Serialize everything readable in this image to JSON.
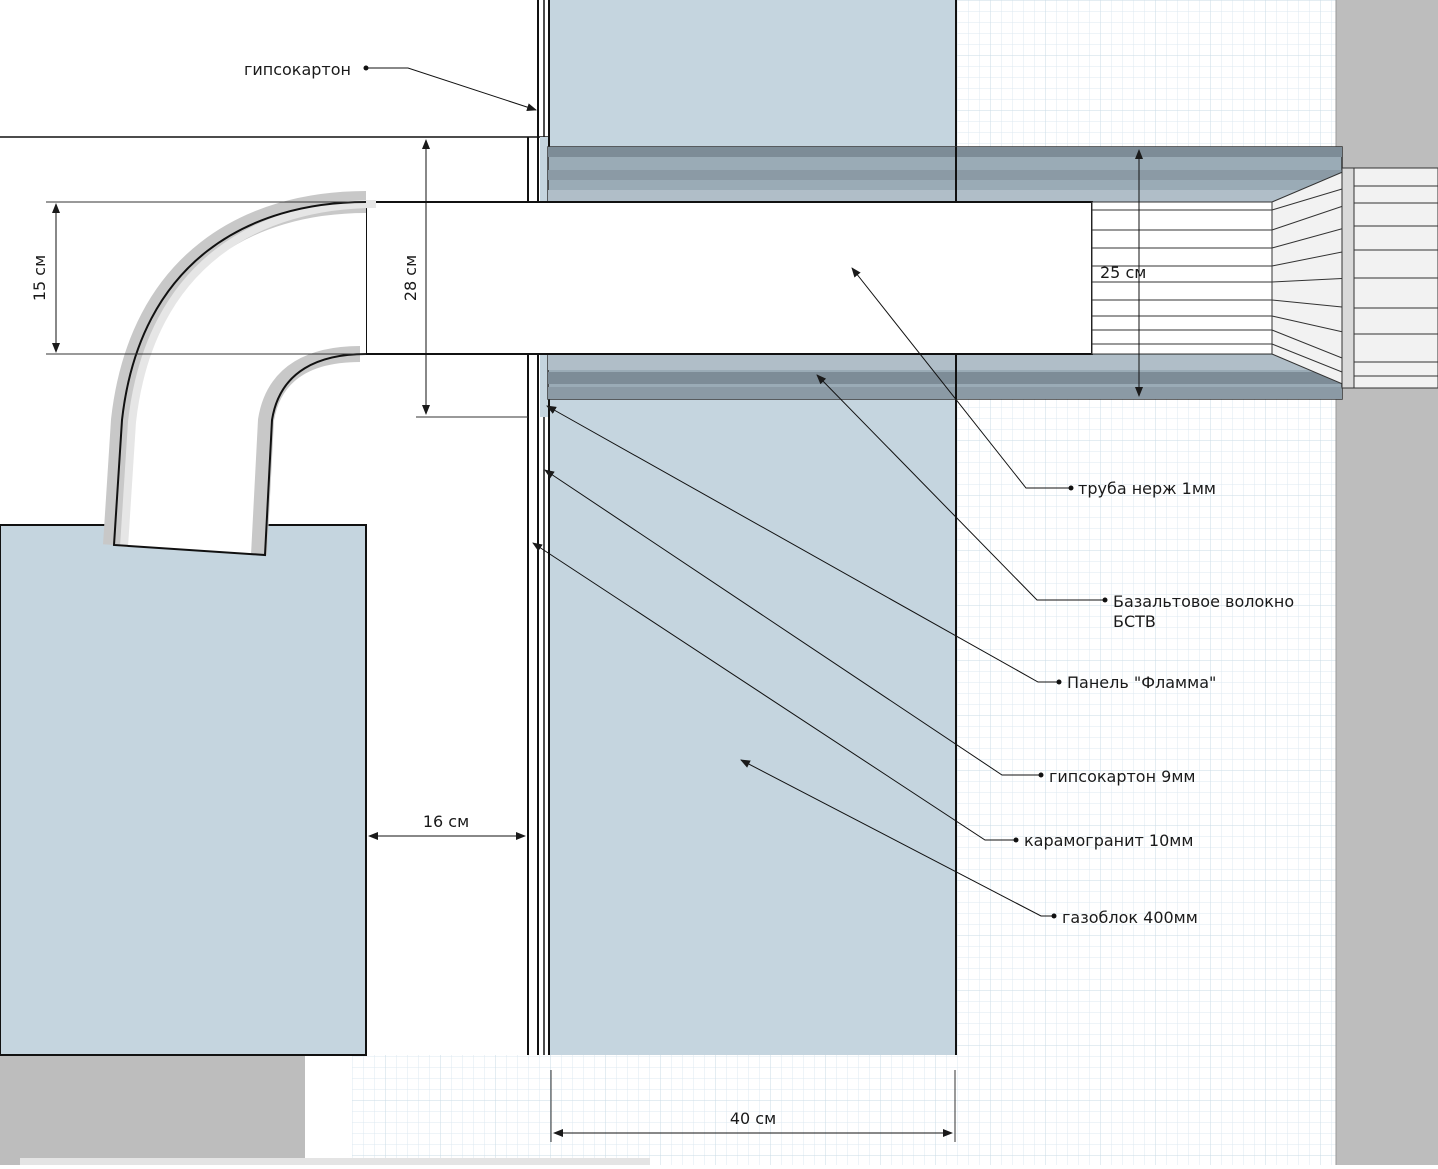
{
  "labels": {
    "gypsum_top": "гипсокартон",
    "pipe": "труба нерж 1мм",
    "basalt_line1": "Базальтовое волокно",
    "basalt_line2": "БСТВ",
    "flamma": "Панель \"Фламма\"",
    "gypsum_9": "гипсокартон 9мм",
    "ceramic": "карамогранит 10мм",
    "gasblock": "газоблок 400мм"
  },
  "dimensions": {
    "d15": "15 см",
    "d28": "28 см",
    "d25": "25 см",
    "d16": "16 см",
    "d40": "40 см"
  },
  "colors": {
    "wall": "#c5d5df",
    "insulation_dark": "#7d8c97",
    "insulation_mid": "#9aabb6",
    "insulation_light": "#b6c4cd",
    "grid": "#d5e5ee",
    "gray_panel": "#bdbdbd"
  }
}
